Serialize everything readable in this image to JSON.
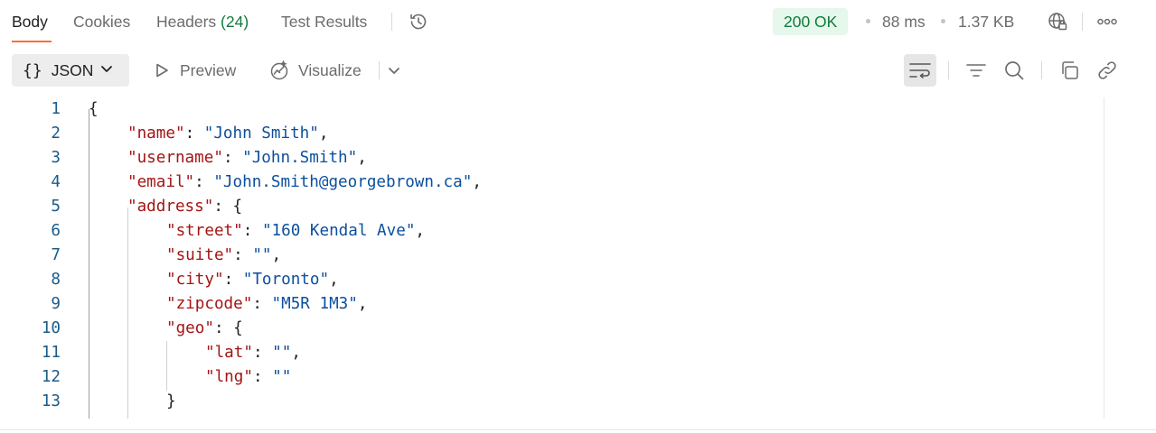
{
  "tabs": {
    "body": "Body",
    "cookies": "Cookies",
    "headers": "Headers",
    "headers_count": "(24)",
    "test_results": "Test Results"
  },
  "response": {
    "status": "200 OK",
    "time": "88 ms",
    "size": "1.37 KB"
  },
  "toolbar": {
    "format_braces": "{}",
    "format": "JSON",
    "preview": "Preview",
    "visualize": "Visualize"
  },
  "editor": {
    "line_numbers": [
      "1",
      "2",
      "3",
      "4",
      "5",
      "6",
      "7",
      "8",
      "9",
      "10",
      "11",
      "12",
      "13"
    ],
    "lines": [
      {
        "indent": 0,
        "open": "{"
      },
      {
        "indent": 1,
        "key": "\"name\"",
        "value": "\"John Smith\"",
        "end": ","
      },
      {
        "indent": 1,
        "key": "\"username\"",
        "value": "\"John.Smith\"",
        "end": ","
      },
      {
        "indent": 1,
        "key": "\"email\"",
        "value": "\"John.Smith@georgebrown.ca\"",
        "end": ","
      },
      {
        "indent": 1,
        "key": "\"address\"",
        "open": "{"
      },
      {
        "indent": 2,
        "key": "\"street\"",
        "value": "\"160 Kendal Ave\"",
        "end": ","
      },
      {
        "indent": 2,
        "key": "\"suite\"",
        "value": "\"\"",
        "end": ","
      },
      {
        "indent": 2,
        "key": "\"city\"",
        "value": "\"Toronto\"",
        "end": ","
      },
      {
        "indent": 2,
        "key": "\"zipcode\"",
        "value": "\"M5R 1M3\"",
        "end": ","
      },
      {
        "indent": 2,
        "key": "\"geo\"",
        "open": "{"
      },
      {
        "indent": 3,
        "key": "\"lat\"",
        "value": "\"\"",
        "end": ","
      },
      {
        "indent": 3,
        "key": "\"lng\"",
        "value": "\"\"",
        "end": ""
      },
      {
        "indent": 2,
        "close": "}"
      }
    ]
  },
  "colors": {
    "accent": "#ff6c37",
    "status_green": "#0f7b3c",
    "status_bg": "#e6f7ec",
    "json_key": "#a31515",
    "json_string": "#0b4f9e",
    "line_number": "#1a5b8a"
  },
  "icons": {
    "history": "history-icon",
    "network": "globe-lock-icon",
    "more": "more-options-icon",
    "preview": "play-icon",
    "visualize": "visualize-icon",
    "wrap": "wrap-lines-icon",
    "filter": "filter-icon",
    "search": "search-icon",
    "copy": "copy-icon",
    "link": "link-icon"
  }
}
